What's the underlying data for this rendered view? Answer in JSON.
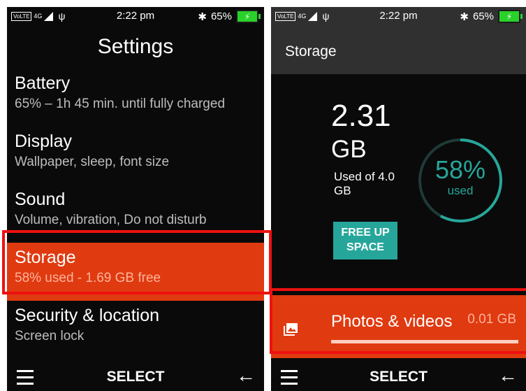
{
  "status_bar": {
    "volte": "VoLTE",
    "network": "4G",
    "time": "2:22 pm",
    "battery_percent": "65%"
  },
  "settings": {
    "title": "Settings",
    "items": [
      {
        "title": "Battery",
        "subtitle": "65% – 1h 45 min. until fully charged"
      },
      {
        "title": "Display",
        "subtitle": "Wallpaper, sleep, font size"
      },
      {
        "title": "Sound",
        "subtitle": "Volume, vibration, Do not disturb"
      },
      {
        "title": "Storage",
        "subtitle": "58% used - 1.69 GB free"
      },
      {
        "title": "Security & location",
        "subtitle": "Screen lock"
      }
    ],
    "selected_index": 3
  },
  "storage": {
    "title": "Storage",
    "used_value": "2.31",
    "used_unit": "GB",
    "used_of": "Used of 4.0 GB",
    "percent": "58%",
    "percent_fraction": 0.58,
    "percent_label": "used",
    "free_up_button": "FREE UP SPACE",
    "photos_label": "Photos & videos",
    "photos_size": "0.01 GB"
  },
  "softkeys": {
    "center": "SELECT"
  },
  "colors": {
    "selected_bg": "#e03a10",
    "accent": "#26a69a",
    "highlight_border": "#ee1111",
    "battery_green": "#2bd12b"
  }
}
